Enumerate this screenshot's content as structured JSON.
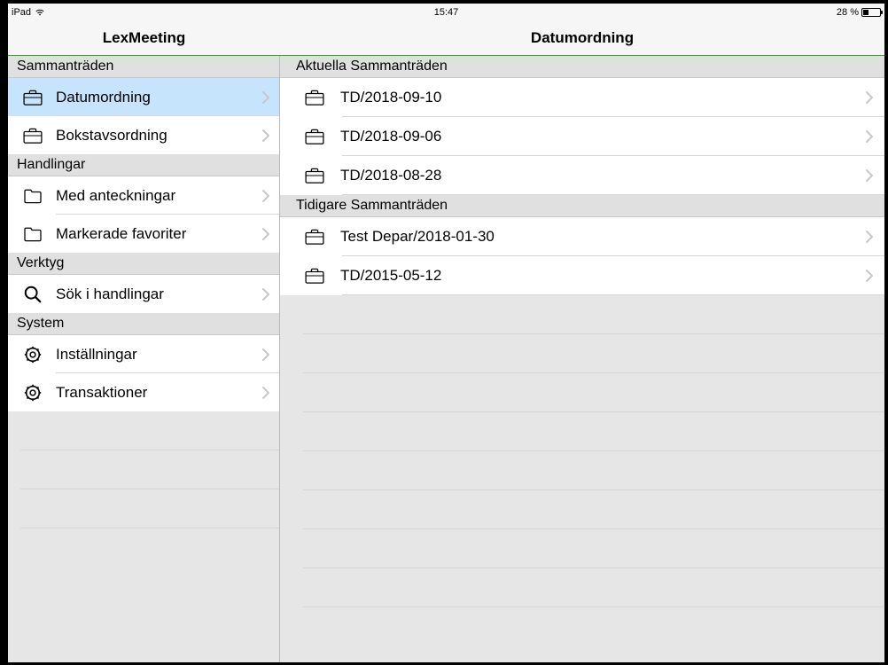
{
  "status": {
    "device": "iPad",
    "time": "15:47",
    "battery_text": "28 %"
  },
  "titles": {
    "left": "LexMeeting",
    "right": "Datumordning"
  },
  "sidebar": {
    "sections": [
      {
        "header": "Sammanträden",
        "items": [
          {
            "label": "Datumordning",
            "icon": "briefcase",
            "selected": true
          },
          {
            "label": "Bokstavsordning",
            "icon": "briefcase",
            "selected": false
          }
        ]
      },
      {
        "header": "Handlingar",
        "items": [
          {
            "label": "Med anteckningar",
            "icon": "folder",
            "selected": false
          },
          {
            "label": "Markerade favoriter",
            "icon": "folder",
            "selected": false
          }
        ]
      },
      {
        "header": "Verktyg",
        "items": [
          {
            "label": "Sök i handlingar",
            "icon": "search",
            "selected": false
          }
        ]
      },
      {
        "header": "System",
        "items": [
          {
            "label": "Inställningar",
            "icon": "gear",
            "selected": false
          },
          {
            "label": "Transaktioner",
            "icon": "gear",
            "selected": false
          }
        ]
      }
    ]
  },
  "main": {
    "sections": [
      {
        "header": "Aktuella Sammanträden",
        "items": [
          {
            "label": "TD/2018-09-10",
            "icon": "briefcase"
          },
          {
            "label": "TD/2018-09-06",
            "icon": "briefcase"
          },
          {
            "label": "TD/2018-08-28",
            "icon": "briefcase"
          }
        ]
      },
      {
        "header": "Tidigare Sammanträden",
        "items": [
          {
            "label": "Test Depar/2018-01-30",
            "icon": "briefcase"
          },
          {
            "label": "TD/2015-05-12",
            "icon": "briefcase"
          }
        ]
      }
    ]
  }
}
